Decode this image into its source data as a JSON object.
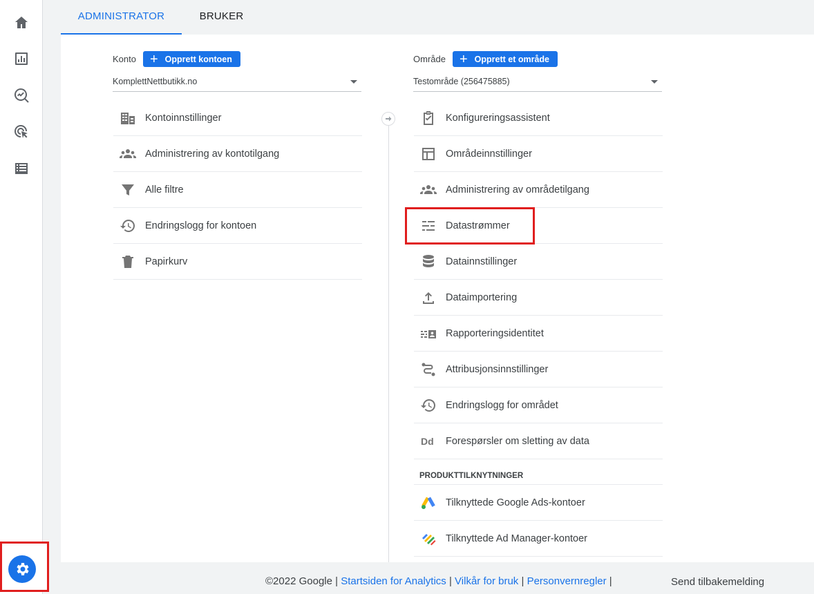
{
  "tabs": {
    "admin": "ADMINISTRATOR",
    "user": "BRUKER"
  },
  "account": {
    "label": "Konto",
    "create_label": "Opprett kontoen",
    "selected": "KomplettNettbutikk.no",
    "items": [
      {
        "label": "Kontoinnstillinger",
        "icon": "building-icon"
      },
      {
        "label": "Administrering av kontotilgang",
        "icon": "people-icon"
      },
      {
        "label": "Alle filtre",
        "icon": "filter-icon"
      },
      {
        "label": "Endringslogg for kontoen",
        "icon": "history-icon"
      },
      {
        "label": "Papirkurv",
        "icon": "trash-icon"
      }
    ]
  },
  "property": {
    "label": "Område",
    "create_label": "Opprett et område",
    "selected": "Testområde (256475885)",
    "items": [
      {
        "label": "Konfigureringsassistent",
        "icon": "clipboard-check-icon"
      },
      {
        "label": "Områdeinnstillinger",
        "icon": "layout-icon"
      },
      {
        "label": "Administrering av områdetilgang",
        "icon": "people-icon"
      },
      {
        "label": "Datastrømmer",
        "icon": "streams-icon"
      },
      {
        "label": "Datainnstillinger",
        "icon": "database-icon"
      },
      {
        "label": "Dataimportering",
        "icon": "upload-icon"
      },
      {
        "label": "Rapporteringsidentitet",
        "icon": "identity-icon"
      },
      {
        "label": "Attribusjonsinnstillinger",
        "icon": "path-icon"
      },
      {
        "label": "Endringslogg for området",
        "icon": "history-icon"
      },
      {
        "label": "Forespørsler om sletting av data",
        "icon": "dd-icon"
      }
    ],
    "section_title": "PRODUKTTILKNYTNINGER",
    "links": [
      {
        "label": "Tilknyttede Google Ads-kontoer",
        "icon": "google-ads-icon"
      },
      {
        "label": "Tilknyttede Ad Manager-kontoer",
        "icon": "ad-manager-icon"
      }
    ]
  },
  "footer": {
    "copyright": "©2022 Google",
    "sep": "|",
    "link1": "Startsiden for Analytics",
    "link2": "Vilkår for bruk",
    "link3": "Personvernregler",
    "feedback": "Send tilbakemelding"
  },
  "colors": {
    "accent": "#1a73e8",
    "highlight": "#e01e1e"
  }
}
